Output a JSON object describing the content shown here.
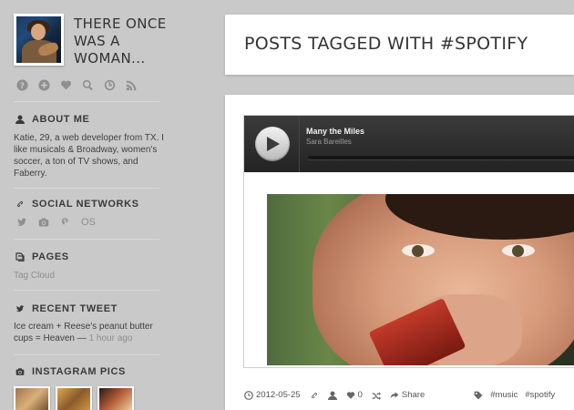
{
  "blog": {
    "title": "THERE ONCE WAS A WOMAN..."
  },
  "nav": [
    "help-icon",
    "plus-icon",
    "heart-icon",
    "search-icon",
    "history-icon",
    "rss-icon"
  ],
  "about": {
    "heading": "ABOUT ME",
    "text": "Katie, 29, a web developer from TX. I like musicals & Broadway, women's soccer, a ton of TV shows, and Faberry."
  },
  "social": {
    "heading": "SOCIAL NETWORKS",
    "os_label": "OS"
  },
  "pages": {
    "heading": "PAGES",
    "tag_cloud": "Tag Cloud"
  },
  "tweet": {
    "heading": "RECENT TWEET",
    "text": "Ice cream + Reese's peanut butter cups = Heaven",
    "separator": " — ",
    "time": "1 hour ago"
  },
  "instagram": {
    "heading": "INSTAGRAM PICS"
  },
  "main": {
    "page_title": "POSTS TAGGED WITH #SPOTIFY"
  },
  "player": {
    "track": "Many the Miles",
    "artist": "Sara Bareilles",
    "progress": 0
  },
  "meta": {
    "date": "2012-05-25",
    "likes": "0",
    "share": "Share",
    "tags": [
      "#music",
      "#spotify"
    ]
  },
  "colors": {
    "background": "#c9c9c9",
    "card": "#ffffff",
    "player_bar": "#2b2b2b",
    "text": "#3b3b3b",
    "muted": "#8e8e8e"
  }
}
